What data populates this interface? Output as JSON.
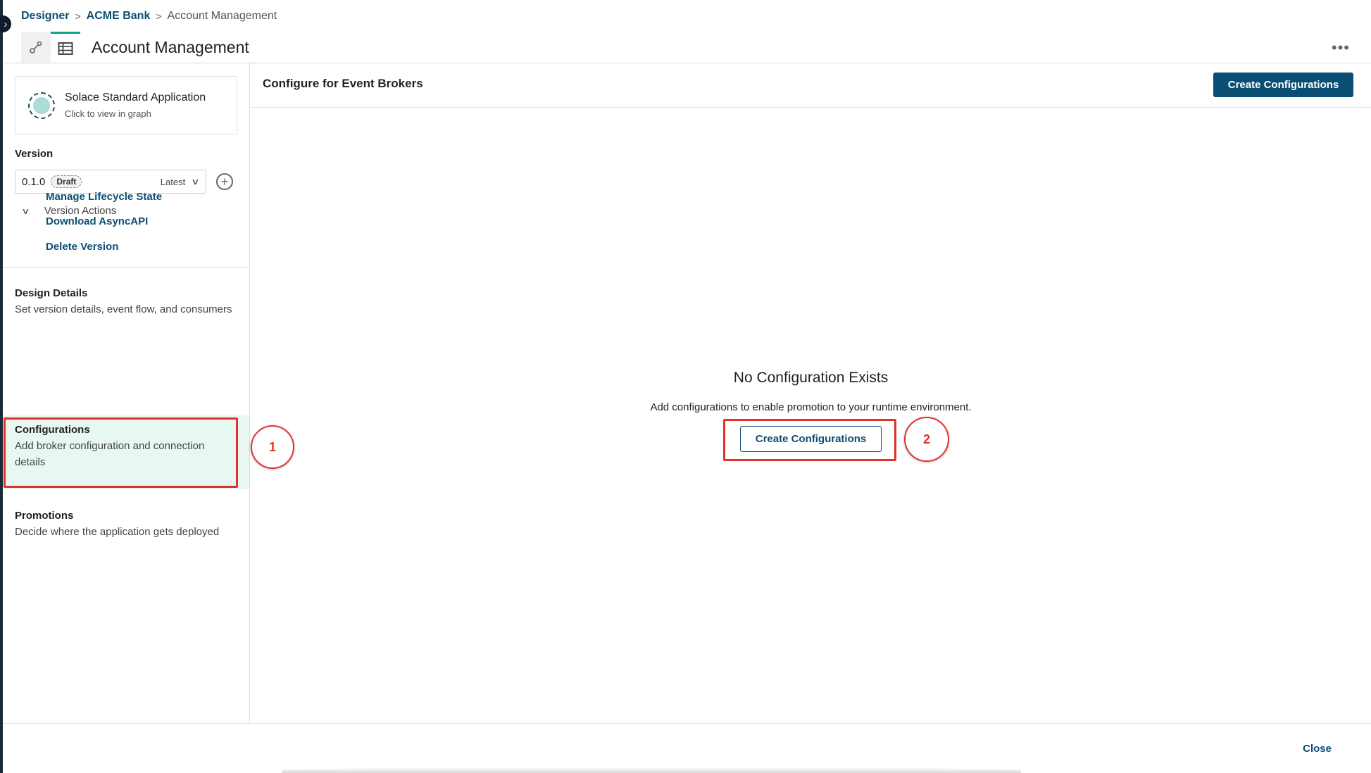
{
  "breadcrumb": {
    "items": [
      "Designer",
      "ACME Bank"
    ],
    "current": "Account Management"
  },
  "header": {
    "title": "Account Management",
    "graph_view_icon": "graph-view-icon",
    "table_view_icon": "table-view-icon",
    "more_label": "•••"
  },
  "app_card": {
    "name": "Solace Standard Application",
    "subtitle": "Click to view in graph"
  },
  "version": {
    "label": "Version",
    "number": "0.1.0",
    "badge": "Draft",
    "selector_text": "Latest",
    "actions_label": "Version Actions",
    "actions": [
      "Manage Lifecycle State",
      "Download AsyncAPI",
      "Delete Version"
    ]
  },
  "nav": {
    "sections": [
      {
        "title": "Design Details",
        "description": "Set version details, event flow, and consumers"
      },
      {
        "title": "Configurations",
        "description": "Add broker configuration and connection details"
      },
      {
        "title": "Promotions",
        "description": "Decide where the application gets deployed"
      }
    ],
    "active": "Configurations"
  },
  "main": {
    "title": "Configure for Event Brokers",
    "primary_button": "Create Configurations",
    "empty_title": "No Configuration Exists",
    "empty_description": "Add configurations to enable promotion to your runtime environment.",
    "empty_button": "Create Configurations"
  },
  "annotations": {
    "step1": "1",
    "step2": "2",
    "color": "#e0322a"
  },
  "footer": {
    "close_label": "Close"
  },
  "colors": {
    "brand": "#0b4e73",
    "accent": "#13a38a",
    "active_bg": "#e8f7f2"
  }
}
